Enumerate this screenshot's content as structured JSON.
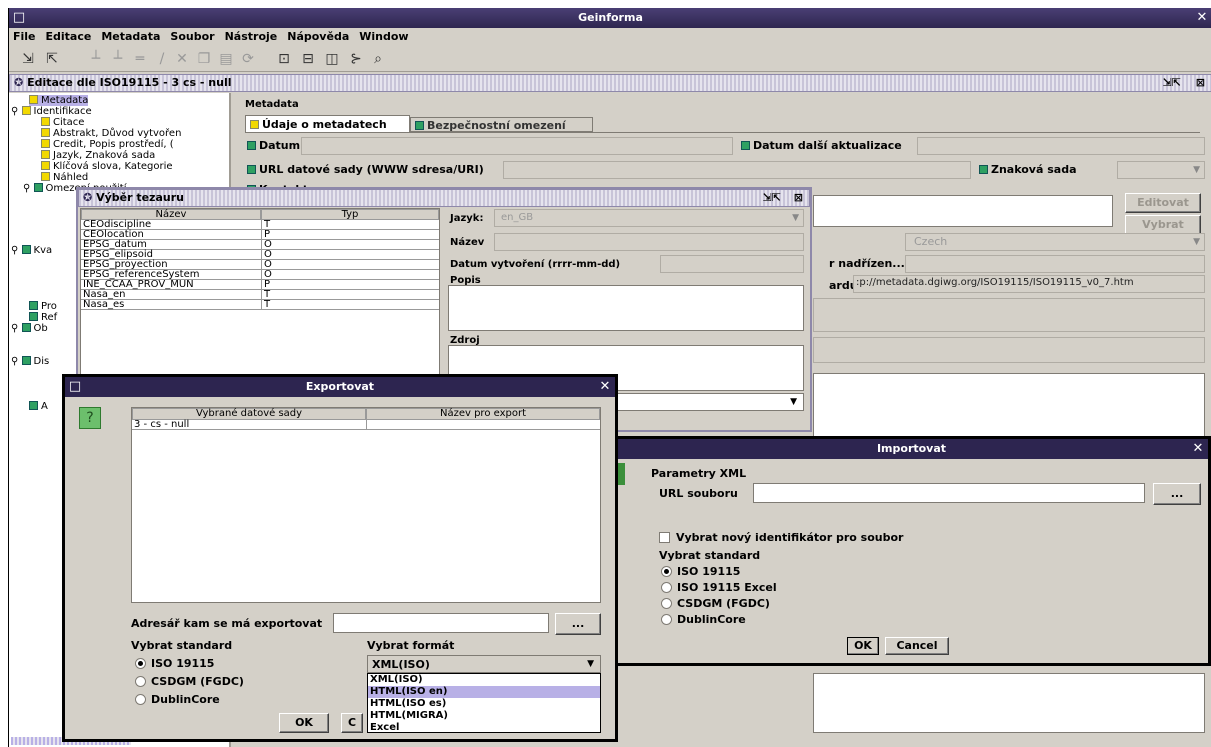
{
  "app": {
    "title": "Geinforma",
    "min": "□",
    "close": "✕"
  },
  "menu": [
    "File",
    "Editace",
    "Metadata",
    "Soubor",
    "Nástroje",
    "Nápověda",
    "Window"
  ],
  "editor": {
    "title": "Editace dle ISO19115 - 3 cs - null",
    "panel_title": "Metadata",
    "tabs": [
      "Údaje o metadatech",
      "Bezpečnostní omezení"
    ],
    "labels": {
      "datum": "Datum",
      "datum_dalsi": "Datum další aktualizace",
      "url": "URL datové sady (WWW sdresa/URI)",
      "znakova": "Znaková sada",
      "kontakt": "Kontakt",
      "nadrizen": "r nadřízen...",
      "ardu": "ardu"
    },
    "buttons": {
      "editovat": "Editovat",
      "vybrat": "Vybrat"
    },
    "czech": "Czech",
    "standard_url": ":p://metadata.dgiwg.org/ISO19115/ISO19115_v0_7.htm"
  },
  "tree": [
    "Metadata",
    "Identifikace",
    "Citace",
    "Abstrakt, Důvod vytvořen",
    "Credit, Popis prostředí, (",
    "Jazyk, Znaková sada",
    "Klíčová slova, Kategorie",
    "Náhled",
    "Omezení použití",
    "Kva",
    "Pro",
    "Ref",
    "Ob",
    "Dis",
    "A"
  ],
  "tezaur": {
    "title": "Výběr tezauru",
    "columns": [
      "Název",
      "Typ"
    ],
    "rows": [
      [
        "CEOdiscipline",
        "T"
      ],
      [
        "CEOlocation",
        "P"
      ],
      [
        "EPSG_datum",
        "O"
      ],
      [
        "EPSG_elipsoid",
        "O"
      ],
      [
        "EPSG_proyection",
        "O"
      ],
      [
        "EPSG_referenceSystem",
        "O"
      ],
      [
        "INE_CCAA_PROV_MUN",
        "P"
      ],
      [
        "Nasa_en",
        "T"
      ],
      [
        "Nasa_es",
        "T"
      ]
    ],
    "labels": {
      "jazyk": "Jazyk:",
      "nazev": "Název",
      "datum": "Datum vytvoření (rrrr-mm-dd)",
      "popis": "Popis",
      "zdroj": "Zdroj"
    },
    "jazyk_value": "en_GB"
  },
  "export": {
    "title": "Exportovat",
    "columns": [
      "Vybrané datové sady",
      "Název pro export"
    ],
    "rows": [
      [
        "3 - cs - null",
        ""
      ]
    ],
    "adresar_label": "Adresář kam se má exportovat",
    "browse": "...",
    "standard_label": "Vybrat standard",
    "standards": [
      "ISO 19115",
      "CSDGM (FGDC)",
      "DublinCore"
    ],
    "format_label": "Vybrat formát",
    "format_selected": "XML(ISO)",
    "format_options": [
      "XML(ISO)",
      "HTML(ISO en)",
      "HTML(ISO es)",
      "HTML(MIGRA)",
      "Excel"
    ],
    "ok": "OK",
    "cancel": "C"
  },
  "import": {
    "title": "Importovat",
    "params": "Parametry XML",
    "url_label": "URL souboru",
    "browse": "...",
    "checkbox": "Vybrat nový identifikátor pro soubor",
    "standard_label": "Vybrat standard",
    "standards": [
      "ISO 19115",
      "ISO 19115 Excel",
      "CSDGM (FGDC)",
      "DublinCore"
    ],
    "ok": "OK",
    "cancel": "Cancel"
  }
}
